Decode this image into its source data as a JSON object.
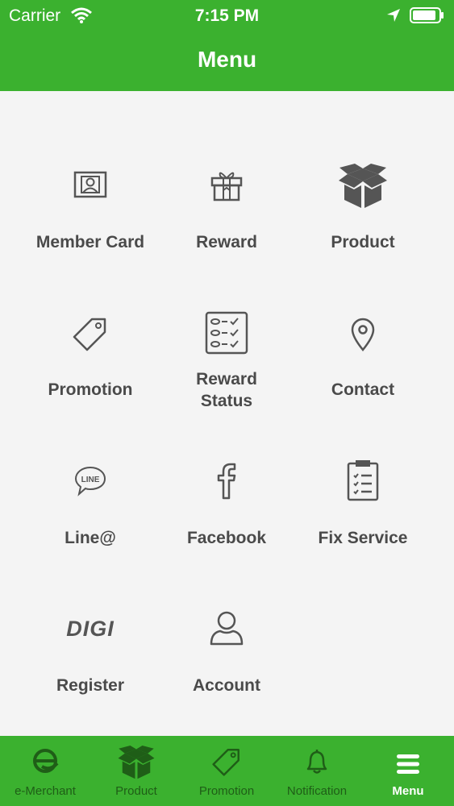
{
  "status_bar": {
    "carrier": "Carrier",
    "time": "7:15 PM"
  },
  "header": {
    "title": "Menu"
  },
  "menu": {
    "items": [
      {
        "label": "Member Card",
        "icon": "member-card-icon"
      },
      {
        "label": "Reward",
        "icon": "gift-icon"
      },
      {
        "label": "Product",
        "icon": "box-icon"
      },
      {
        "label": "Promotion",
        "icon": "tag-icon"
      },
      {
        "label": "Reward Status",
        "icon": "checklist-icon"
      },
      {
        "label": "Contact",
        "icon": "location-pin-icon"
      },
      {
        "label": "Line@",
        "icon": "line-icon",
        "icon_text": "LINE"
      },
      {
        "label": "Facebook",
        "icon": "facebook-icon"
      },
      {
        "label": "Fix Service",
        "icon": "clipboard-icon"
      },
      {
        "label": "Register",
        "icon": "digi-logo-icon",
        "icon_text": "DIGI"
      },
      {
        "label": "Account",
        "icon": "user-icon"
      }
    ]
  },
  "tabbar": {
    "tabs": [
      {
        "label": "e-Merchant",
        "icon": "e-merchant-icon",
        "active": false
      },
      {
        "label": "Product",
        "icon": "box-icon",
        "active": false
      },
      {
        "label": "Promotion",
        "icon": "tag-icon",
        "active": false
      },
      {
        "label": "Notification",
        "icon": "bell-icon",
        "active": false
      },
      {
        "label": "Menu",
        "icon": "hamburger-icon",
        "active": true
      }
    ]
  },
  "colors": {
    "brand_green": "#3bb12f",
    "inactive_tab": "#1f5e17",
    "label_gray": "#4a4a4a",
    "background": "#f4f4f4"
  }
}
